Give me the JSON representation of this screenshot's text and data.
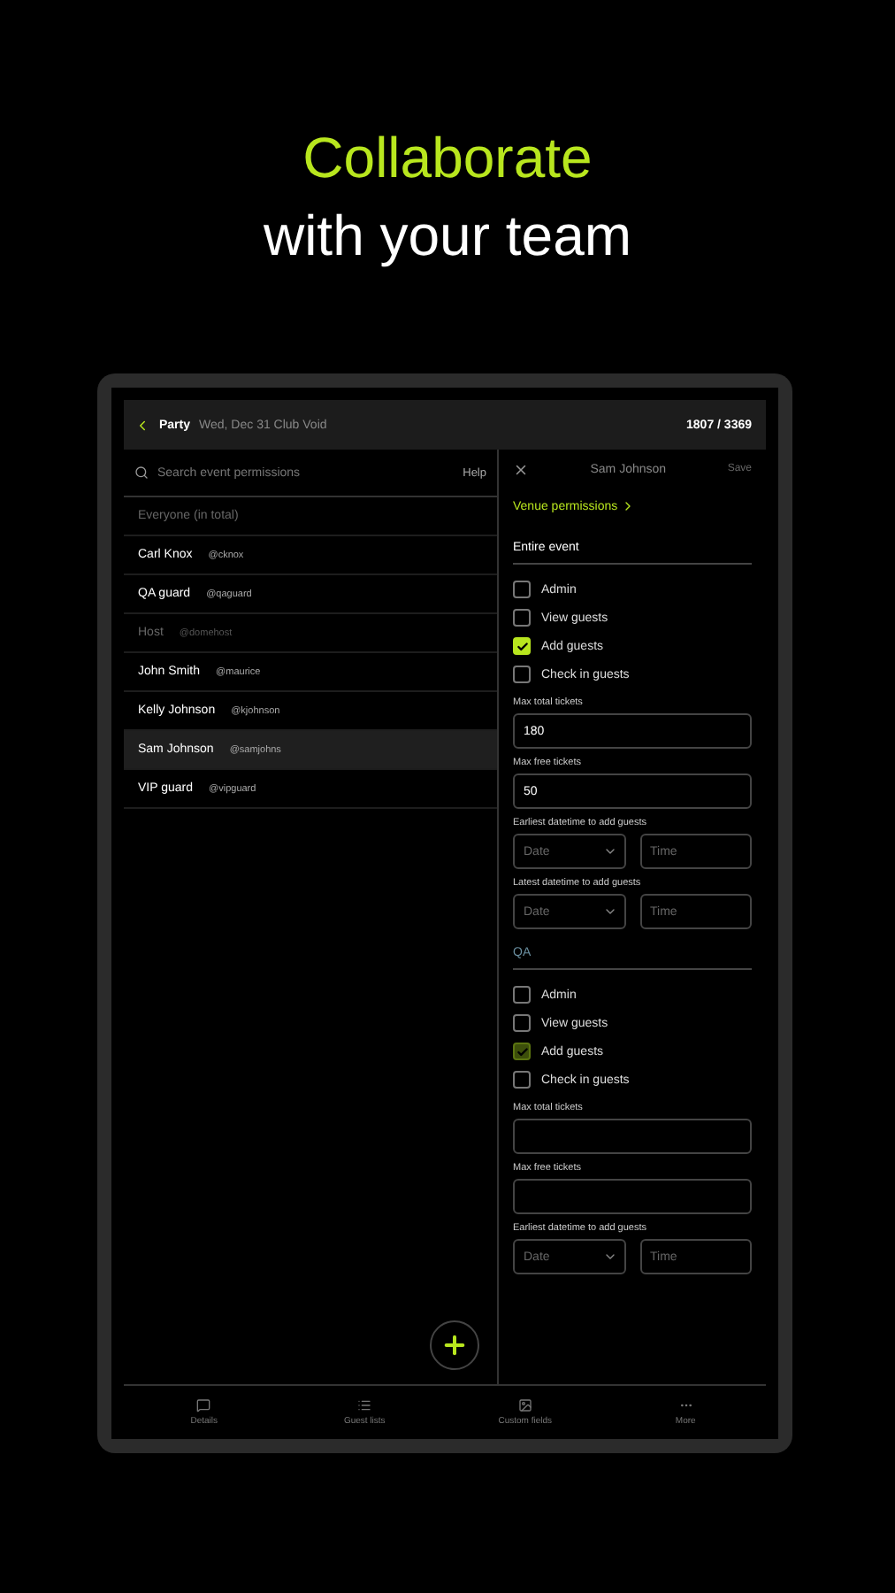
{
  "headline": {
    "accent": "Collaborate",
    "rest": "with your team"
  },
  "header": {
    "title": "Party",
    "subtitle": "Wed, Dec 31  Club Void",
    "count": "1807 / 3369"
  },
  "search": {
    "placeholder": "Search event permissions",
    "help": "Help"
  },
  "members": [
    {
      "name": "Everyone (in total)",
      "dimmed": true,
      "selected": false
    },
    {
      "name": "Carl Knox",
      "handle": "@cknox",
      "dimmed": false,
      "selected": false
    },
    {
      "name": "QA guard",
      "handle": "@qaguard",
      "dimmed": false,
      "selected": false
    },
    {
      "name": "Host",
      "handle": "@domehost",
      "dimmed": true,
      "selected": false
    },
    {
      "name": "John Smith",
      "handle": "@maurice",
      "dimmed": false,
      "selected": false
    },
    {
      "name": "Kelly Johnson",
      "handle": "@kjohnson",
      "dimmed": false,
      "selected": false
    },
    {
      "name": "Sam Johnson",
      "handle": "@samjohns",
      "dimmed": false,
      "selected": true
    },
    {
      "name": "VIP guard",
      "handle": "@vipguard",
      "dimmed": false,
      "selected": false
    }
  ],
  "panel": {
    "title": "Sam Johnson",
    "save": "Save",
    "venue_link": "Venue permissions"
  },
  "sections": [
    {
      "title": "Entire event",
      "dimmed": false,
      "checks": [
        {
          "label": "Admin",
          "checked": false
        },
        {
          "label": "View guests",
          "checked": false
        },
        {
          "label": "Add guests",
          "checked": true
        },
        {
          "label": "Check in guests",
          "checked": false
        }
      ],
      "fields": [
        {
          "kind": "text",
          "label": "Max total tickets",
          "value": "180"
        },
        {
          "kind": "text",
          "label": "Max free tickets",
          "value": "50"
        },
        {
          "kind": "datetime",
          "label": "Earliest datetime to add guests",
          "date": "Date",
          "time": "Time"
        },
        {
          "kind": "datetime",
          "label": "Latest datetime to add guests",
          "date": "Date",
          "time": "Time"
        }
      ]
    },
    {
      "title": "QA",
      "dimmed": true,
      "checks": [
        {
          "label": "Admin",
          "checked": false
        },
        {
          "label": "View guests",
          "checked": false
        },
        {
          "label": "Add guests",
          "checked": true
        },
        {
          "label": "Check in guests",
          "checked": false
        }
      ],
      "fields": [
        {
          "kind": "text",
          "label": "Max total tickets"
        },
        {
          "kind": "text",
          "label": "Max free tickets"
        },
        {
          "kind": "datetime",
          "label": "Earliest datetime to add guests",
          "date": "Date",
          "time": "Time"
        }
      ]
    }
  ],
  "nav": [
    {
      "kind": "details",
      "label": "Details"
    },
    {
      "kind": "lists",
      "label": "Guest lists"
    },
    {
      "kind": "fields",
      "label": "Custom fields"
    },
    {
      "kind": "more",
      "label": "More"
    }
  ]
}
